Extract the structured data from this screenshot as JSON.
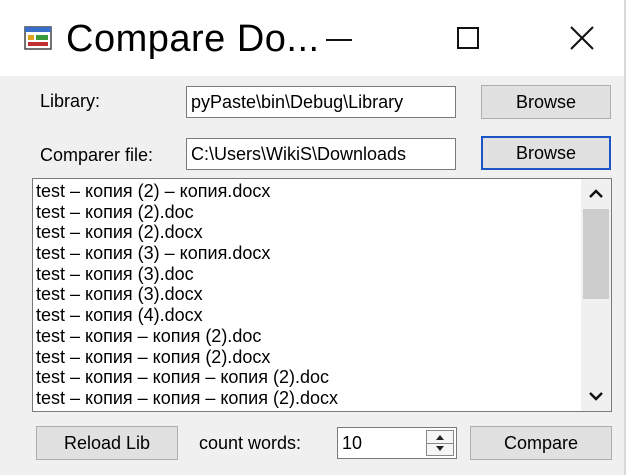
{
  "window": {
    "title": "Compare Do..."
  },
  "library": {
    "label": "Library:",
    "path": "pyPaste\\bin\\Debug\\Library",
    "browse_label": "Browse"
  },
  "comparer": {
    "label": "Comparer file:",
    "path": "C:\\Users\\WikiS\\Downloads",
    "browse_label": "Browse"
  },
  "file_list": [
    "test – копия (2) – копия.docx",
    "test – копия (2).doc",
    "test – копия (2).docx",
    "test – копия (3) – копия.docx",
    "test – копия (3).doc",
    "test – копия (3).docx",
    "test – копия (4).docx",
    "test – копия – копия (2).doc",
    "test – копия – копия (2).docx",
    "test – копия – копия – копия (2).doc",
    "test – копия – копия – копия (2).docx"
  ],
  "footer": {
    "reload_label": "Reload Lib",
    "count_label": "count words:",
    "count_value": "10",
    "compare_label": "Compare"
  },
  "colors": {
    "focus_border": "#1b56c4",
    "button_bg": "#e1e1e1",
    "window_bg": "#f0f0f0"
  }
}
